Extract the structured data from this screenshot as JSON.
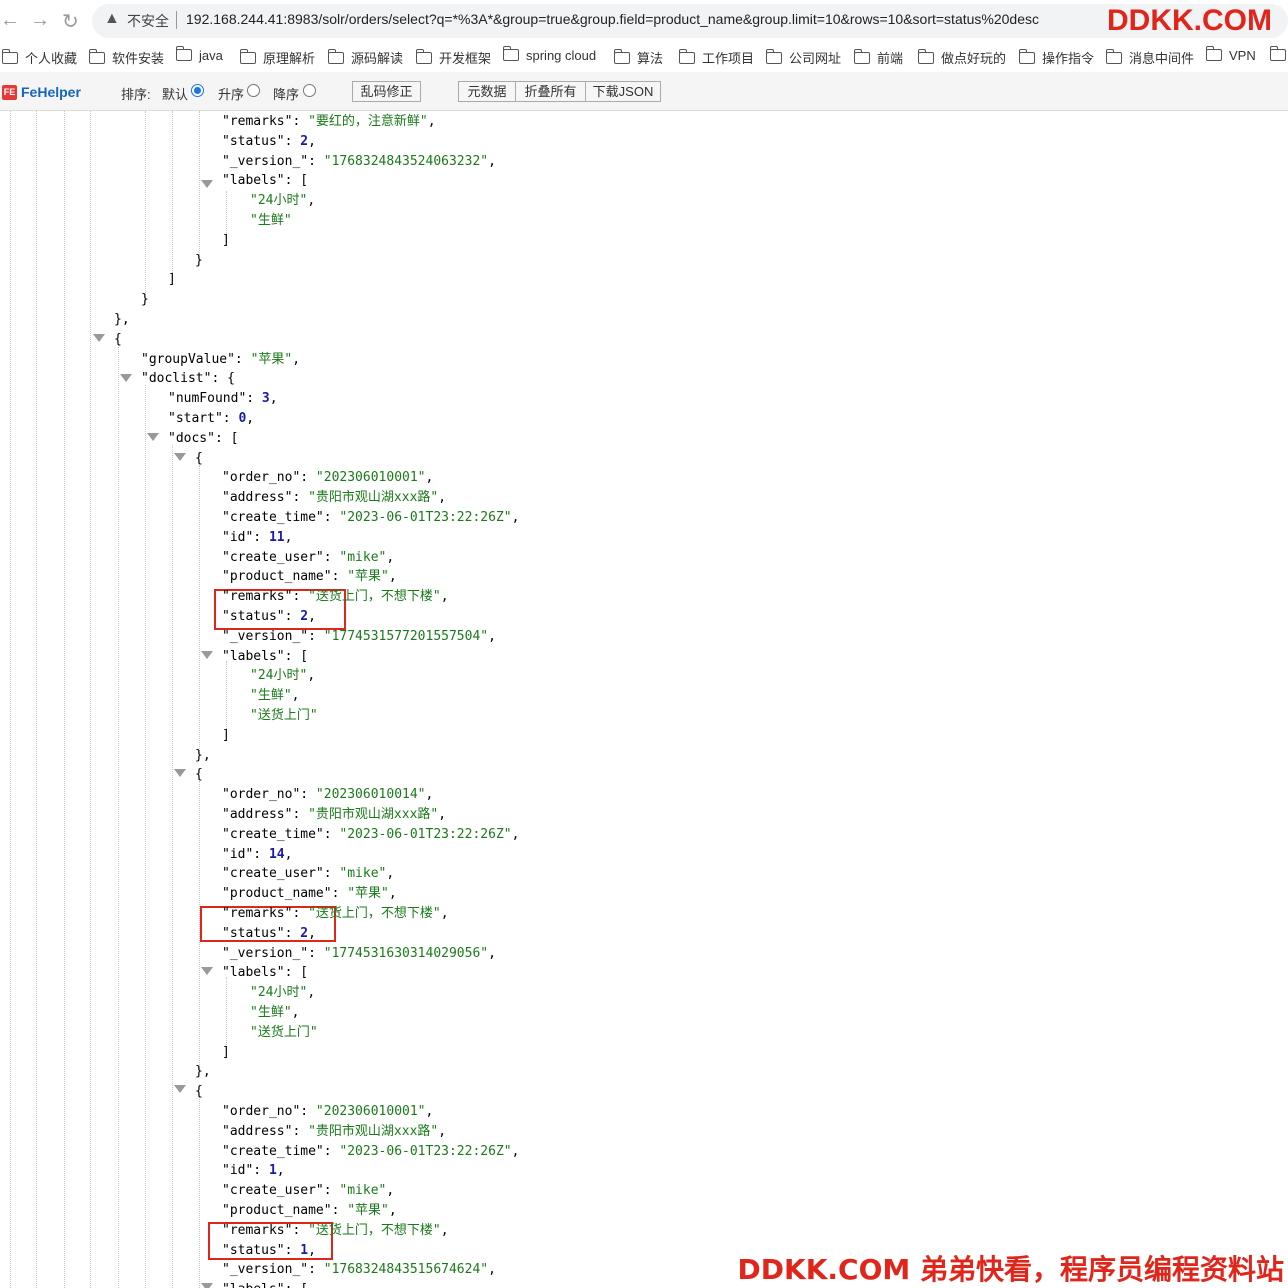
{
  "browser": {
    "back_icon": "←",
    "forward_icon": "→",
    "reload_icon": "↻",
    "warn_icon": "▲",
    "insecure_label": "不安全",
    "url": "192.168.244.41:8983/solr/orders/select?q=*%3A*&group=true&group.field=product_name&group.limit=10&rows=10&sort=status%20desc"
  },
  "watermark_top": "DDKK.COM",
  "watermark_bottom": "DDKK.COM 弟弟快看，程序员编程资料站",
  "bookmarks": [
    "个人收藏",
    "软件安装",
    "java",
    "原理解析",
    "源码解读",
    "开发框架",
    "spring cloud",
    "算法",
    "工作项目",
    "公司网址",
    "前端",
    "做点好玩的",
    "操作指令",
    "消息中间件",
    "VPN"
  ],
  "fehelper": {
    "logo": "FE",
    "name": "FeHelper",
    "sort_label": "排序:",
    "opt_default": "默认",
    "opt_asc": "升序",
    "opt_desc": "降序",
    "btn_fix": "乱码修正",
    "btn_meta": "元数据",
    "btn_fold": "折叠所有",
    "btn_download": "下载JSON"
  },
  "json_lines": [
    {
      "k": "remarks",
      "v": "\"要红的，注意新鲜\"",
      "t": "s",
      "c": ","
    },
    {
      "k": "status",
      "v": "2",
      "t": "n",
      "c": ","
    },
    {
      "k": "_version_",
      "v": "\"1768324843524063232\"",
      "t": "s",
      "c": ","
    },
    {
      "k": "labels",
      "v": "[",
      "t": "p",
      "c": ""
    },
    {
      "v": "\"24小时\"",
      "t": "s",
      "c": ","
    },
    {
      "v": "\"生鲜\"",
      "t": "s",
      "c": ""
    },
    {
      "v": "]",
      "t": "p",
      "c": ""
    },
    {
      "v": "}",
      "t": "p",
      "c": ""
    },
    {
      "v": "]",
      "t": "p",
      "c": ""
    },
    {
      "v": "}",
      "t": "p",
      "c": ""
    },
    {
      "v": "}",
      "t": "p",
      "c": ","
    },
    {
      "v": "{",
      "t": "p",
      "c": ""
    },
    {
      "k": "groupValue",
      "v": "\"苹果\"",
      "t": "s",
      "c": ","
    },
    {
      "k": "doclist",
      "v": "{",
      "t": "p",
      "c": ""
    },
    {
      "k": "numFound",
      "v": "3",
      "t": "n",
      "c": ","
    },
    {
      "k": "start",
      "v": "0",
      "t": "n",
      "c": ","
    },
    {
      "k": "docs",
      "v": "[",
      "t": "p",
      "c": ""
    },
    {
      "v": "{",
      "t": "p",
      "c": ""
    },
    {
      "k": "order_no",
      "v": "\"202306010001\"",
      "t": "s",
      "c": ","
    },
    {
      "k": "address",
      "v": "\"贵阳市观山湖xxx路\"",
      "t": "s",
      "c": ","
    },
    {
      "k": "create_time",
      "v": "\"2023-06-01T23:22:26Z\"",
      "t": "s",
      "c": ","
    },
    {
      "k": "id",
      "v": "11",
      "t": "n",
      "c": ","
    },
    {
      "k": "create_user",
      "v": "\"mike\"",
      "t": "s",
      "c": ","
    },
    {
      "k": "product_name",
      "v": "\"苹果\"",
      "t": "s",
      "c": ","
    },
    {
      "k": "remarks",
      "v": "\"送货上门，不想下楼\"",
      "t": "s",
      "c": ","
    },
    {
      "k": "status",
      "v": "2",
      "t": "n",
      "c": ","
    },
    {
      "k": "_version_",
      "v": "\"1774531577201557504\"",
      "t": "s",
      "c": ","
    },
    {
      "k": "labels",
      "v": "[",
      "t": "p",
      "c": ""
    },
    {
      "v": "\"24小时\"",
      "t": "s",
      "c": ","
    },
    {
      "v": "\"生鲜\"",
      "t": "s",
      "c": ","
    },
    {
      "v": "\"送货上门\"",
      "t": "s",
      "c": ""
    },
    {
      "v": "]",
      "t": "p",
      "c": ""
    },
    {
      "v": "}",
      "t": "p",
      "c": ","
    },
    {
      "v": "{",
      "t": "p",
      "c": ""
    },
    {
      "k": "order_no",
      "v": "\"202306010014\"",
      "t": "s",
      "c": ","
    },
    {
      "k": "address",
      "v": "\"贵阳市观山湖xxx路\"",
      "t": "s",
      "c": ","
    },
    {
      "k": "create_time",
      "v": "\"2023-06-01T23:22:26Z\"",
      "t": "s",
      "c": ","
    },
    {
      "k": "id",
      "v": "14",
      "t": "n",
      "c": ","
    },
    {
      "k": "create_user",
      "v": "\"mike\"",
      "t": "s",
      "c": ","
    },
    {
      "k": "product_name",
      "v": "\"苹果\"",
      "t": "s",
      "c": ","
    },
    {
      "k": "remarks",
      "v": "\"送货上门，不想下楼\"",
      "t": "s",
      "c": ","
    },
    {
      "k": "status",
      "v": "2",
      "t": "n",
      "c": ","
    },
    {
      "k": "_version_",
      "v": "\"1774531630314029056\"",
      "t": "s",
      "c": ","
    },
    {
      "k": "labels",
      "v": "[",
      "t": "p",
      "c": ""
    },
    {
      "v": "\"24小时\"",
      "t": "s",
      "c": ","
    },
    {
      "v": "\"生鲜\"",
      "t": "s",
      "c": ","
    },
    {
      "v": "\"送货上门\"",
      "t": "s",
      "c": ""
    },
    {
      "v": "]",
      "t": "p",
      "c": ""
    },
    {
      "v": "}",
      "t": "p",
      "c": ","
    },
    {
      "v": "{",
      "t": "p",
      "c": ""
    },
    {
      "k": "order_no",
      "v": "\"202306010001\"",
      "t": "s",
      "c": ","
    },
    {
      "k": "address",
      "v": "\"贵阳市观山湖xxx路\"",
      "t": "s",
      "c": ","
    },
    {
      "k": "create_time",
      "v": "\"2023-06-01T23:22:26Z\"",
      "t": "s",
      "c": ","
    },
    {
      "k": "id",
      "v": "1",
      "t": "n",
      "c": ","
    },
    {
      "k": "create_user",
      "v": "\"mike\"",
      "t": "s",
      "c": ","
    },
    {
      "k": "product_name",
      "v": "\"苹果\"",
      "t": "s",
      "c": ","
    },
    {
      "k": "remarks",
      "v": "\"送货上门，不想下楼\"",
      "t": "s",
      "c": ","
    },
    {
      "k": "status",
      "v": "1",
      "t": "n",
      "c": ","
    },
    {
      "k": "_version_",
      "v": "\"1768324843515674624\"",
      "t": "s",
      "c": ","
    },
    {
      "k": "labels",
      "v": "[",
      "t": "p",
      "c": ""
    }
  ]
}
